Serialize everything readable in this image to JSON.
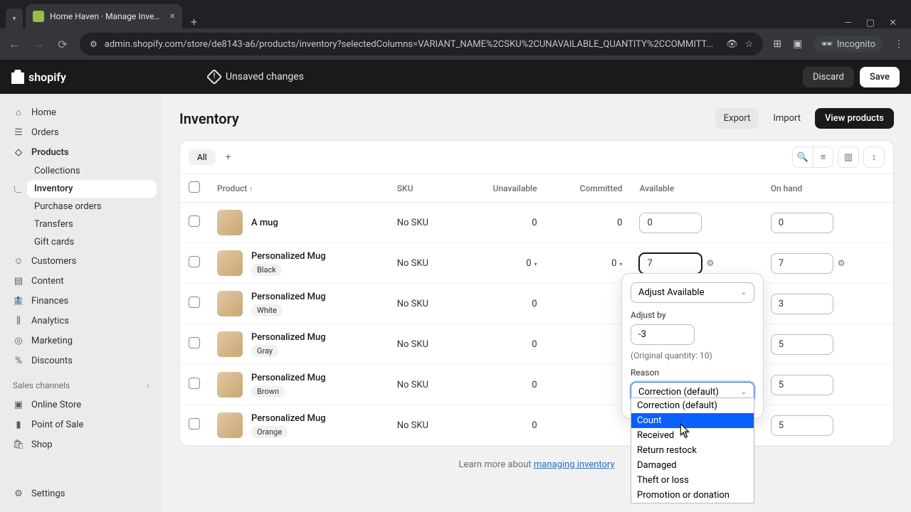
{
  "browser": {
    "tab_title": "Home Haven · Manage Invento",
    "url": "admin.shopify.com/store/de8143-a6/products/inventory?selectedColumns=VARIANT_NAME%2CSKU%2CUNAVAILABLE_QUANTITY%2CCOMMITT...",
    "incognito": "Incognito"
  },
  "topbar": {
    "brand": "shopify",
    "unsaved": "Unsaved changes",
    "discard": "Discard",
    "save": "Save"
  },
  "sidebar": {
    "items": [
      {
        "label": "Home"
      },
      {
        "label": "Orders"
      },
      {
        "label": "Products"
      },
      {
        "label": "Customers"
      },
      {
        "label": "Content"
      },
      {
        "label": "Finances"
      },
      {
        "label": "Analytics"
      },
      {
        "label": "Marketing"
      },
      {
        "label": "Discounts"
      }
    ],
    "products_sub": [
      {
        "label": "Collections"
      },
      {
        "label": "Inventory"
      },
      {
        "label": "Purchase orders"
      },
      {
        "label": "Transfers"
      },
      {
        "label": "Gift cards"
      }
    ],
    "channels_label": "Sales channels",
    "channels": [
      {
        "label": "Online Store"
      },
      {
        "label": "Point of Sale"
      },
      {
        "label": "Shop"
      }
    ],
    "settings": "Settings"
  },
  "page": {
    "title": "Inventory",
    "export": "Export",
    "import": "Import",
    "view_products": "View products",
    "tab_all": "All"
  },
  "table": {
    "headers": {
      "product": "Product",
      "sku": "SKU",
      "unavailable": "Unavailable",
      "committed": "Committed",
      "available": "Available",
      "on_hand": "On hand"
    },
    "rows": [
      {
        "name": "A mug",
        "variant": "",
        "sku": "No SKU",
        "unavailable": "0",
        "committed": "0",
        "available": "0",
        "on_hand": "0"
      },
      {
        "name": "Personalized Mug",
        "variant": "Black",
        "sku": "No SKU",
        "unavailable": "0",
        "committed": "0",
        "available": "7",
        "on_hand": "7"
      },
      {
        "name": "Personalized Mug",
        "variant": "White",
        "sku": "No SKU",
        "unavailable": "0",
        "committed": "",
        "available": "",
        "on_hand": "3"
      },
      {
        "name": "Personalized Mug",
        "variant": "Gray",
        "sku": "No SKU",
        "unavailable": "0",
        "committed": "",
        "available": "",
        "on_hand": "5"
      },
      {
        "name": "Personalized Mug",
        "variant": "Brown",
        "sku": "No SKU",
        "unavailable": "0",
        "committed": "",
        "available": "",
        "on_hand": "5"
      },
      {
        "name": "Personalized Mug",
        "variant": "Orange",
        "sku": "No SKU",
        "unavailable": "0",
        "committed": "",
        "available": "",
        "on_hand": "5"
      }
    ]
  },
  "popover": {
    "mode": "Adjust Available",
    "adjust_by_label": "Adjust by",
    "adjust_by_value": "-3",
    "original": "(Original quantity: 10)",
    "reason_label": "Reason",
    "reason_value": "Correction (default)",
    "options": [
      "Correction (default)",
      "Count",
      "Received",
      "Return restock",
      "Damaged",
      "Theft or loss",
      "Promotion or donation"
    ]
  },
  "footer": {
    "prefix": "Learn more about ",
    "link": "managing inventory"
  }
}
